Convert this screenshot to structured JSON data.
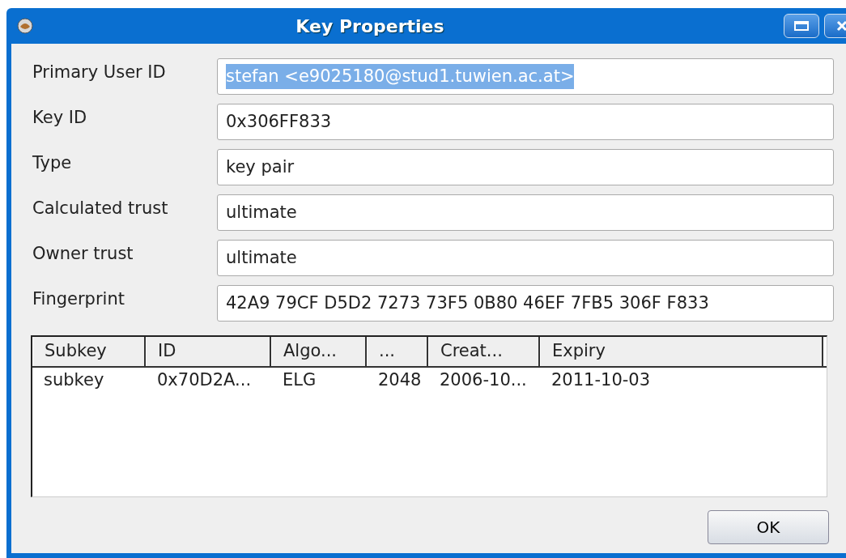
{
  "window": {
    "title": "Key Properties"
  },
  "fields": [
    {
      "label": "Primary User ID",
      "value": "stefan <e9025180@stud1.tuwien.ac.at>",
      "text_selected": true
    },
    {
      "label": "Key ID",
      "value": "0x306FF833",
      "text_selected": false
    },
    {
      "label": "Type",
      "value": "key pair",
      "text_selected": false
    },
    {
      "label": "Calculated trust",
      "value": "ultimate",
      "text_selected": false
    },
    {
      "label": "Owner trust",
      "value": "ultimate",
      "text_selected": false
    },
    {
      "label": "Fingerprint",
      "value": "42A9 79CF D5D2 7273 73F5 0B80 46EF 7FB5 306F F833",
      "text_selected": false
    }
  ],
  "table": {
    "columns": [
      "Subkey",
      "ID",
      "Algo...",
      "...",
      "Creat...",
      "Expiry"
    ],
    "rows": [
      [
        "subkey",
        "0x70D2A...",
        "ELG",
        "2048",
        "2006-10...",
        "2011-10-03"
      ]
    ]
  },
  "buttons": [
    "OK"
  ]
}
